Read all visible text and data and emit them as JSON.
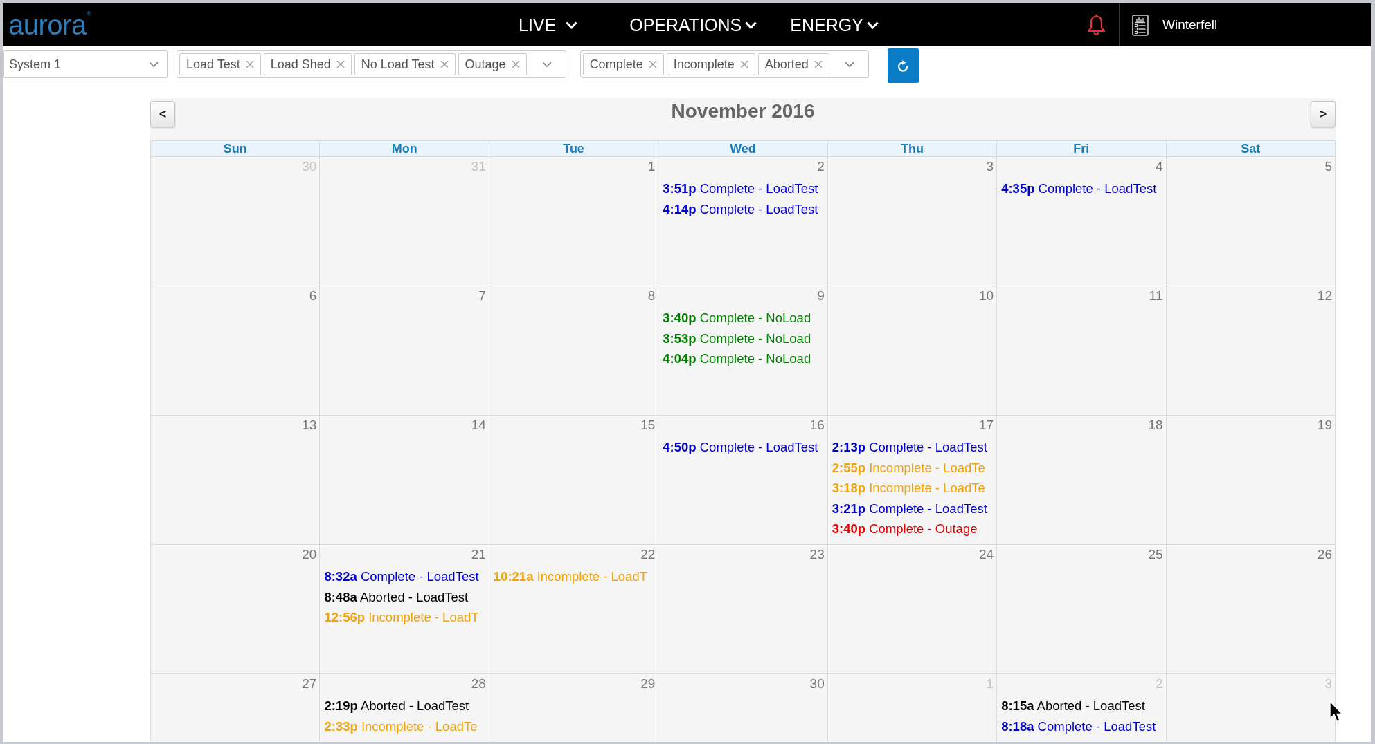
{
  "nav": {
    "logo": "aurora$^{®}$",
    "menus": [
      {
        "label": "LIVE"
      },
      {
        "label": "OPERATIONS"
      },
      {
        "label": "ENERGY"
      }
    ],
    "site": "Winterfell"
  },
  "filters": {
    "system": {
      "value": "System 1"
    },
    "event_types": [
      {
        "label": "Load Test"
      },
      {
        "label": "Load Shed"
      },
      {
        "label": "No Load Test"
      },
      {
        "label": "Outage"
      }
    ],
    "statuses": [
      {
        "label": "Complete"
      },
      {
        "label": "Incomplete"
      },
      {
        "label": "Aborted"
      }
    ]
  },
  "calendar": {
    "title": "November 2016",
    "prev": "<",
    "next": ">",
    "weekdays": [
      "Sun",
      "Mon",
      "Tue",
      "Wed",
      "Thu",
      "Fri",
      "Sat"
    ],
    "weeks": [
      {
        "days": [
          {
            "day": "30",
            "other_month": true
          },
          {
            "day": "31",
            "other_month": true
          },
          {
            "day": "1",
            "other_month": false
          },
          {
            "day": "2",
            "other_month": false,
            "events": [
              {
                "time": "3:51p",
                "text": "Complete - LoadTest",
                "color": "#0000cc"
              },
              {
                "time": "4:14p",
                "text": "Complete - LoadTest",
                "color": "#0000cc"
              }
            ]
          },
          {
            "day": "3",
            "other_month": false
          },
          {
            "day": "4",
            "other_month": false,
            "events": [
              {
                "time": "4:35p",
                "text": "Complete - LoadTest",
                "color": "#0000cc"
              }
            ]
          },
          {
            "day": "5",
            "other_month": false
          }
        ]
      },
      {
        "days": [
          {
            "day": "6",
            "other_month": false
          },
          {
            "day": "7",
            "other_month": false
          },
          {
            "day": "8",
            "other_month": false
          },
          {
            "day": "9",
            "other_month": false,
            "events": [
              {
                "time": "3:40p",
                "text": "Complete - NoLoad",
                "color": "#008000"
              },
              {
                "time": "3:53p",
                "text": "Complete - NoLoad",
                "color": "#008000"
              },
              {
                "time": "4:04p",
                "text": "Complete - NoLoad",
                "color": "#008000"
              }
            ]
          },
          {
            "day": "10",
            "other_month": false
          },
          {
            "day": "11",
            "other_month": false
          },
          {
            "day": "12",
            "other_month": false
          }
        ]
      },
      {
        "days": [
          {
            "day": "13",
            "other_month": false
          },
          {
            "day": "14",
            "other_month": false
          },
          {
            "day": "15",
            "other_month": false
          },
          {
            "day": "16",
            "other_month": false,
            "events": [
              {
                "time": "4:50p",
                "text": "Complete - LoadTest",
                "color": "#0000cc"
              }
            ]
          },
          {
            "day": "17",
            "other_month": false,
            "events": [
              {
                "time": "2:13p",
                "text": "Complete - LoadTest",
                "color": "#0000cc"
              },
              {
                "time": "2:55p",
                "text": "Incomplete - LoadTe",
                "color": "#f0a30a"
              },
              {
                "time": "3:18p",
                "text": "Incomplete - LoadTe",
                "color": "#f0a30a"
              },
              {
                "time": "3:21p",
                "text": "Complete - LoadTest",
                "color": "#0000cc"
              },
              {
                "time": "3:40p",
                "text": "Complete - Outage",
                "color": "#e00000"
              }
            ]
          },
          {
            "day": "18",
            "other_month": false
          },
          {
            "day": "19",
            "other_month": false
          }
        ]
      },
      {
        "days": [
          {
            "day": "20",
            "other_month": false
          },
          {
            "day": "21",
            "other_month": false,
            "events": [
              {
                "time": "8:32a",
                "text": "Complete - LoadTest",
                "color": "#0000cc"
              },
              {
                "time": "8:48a",
                "text": "Aborted - LoadTest",
                "color": "#000000"
              },
              {
                "time": "12:56p",
                "text": "Incomplete - LoadT",
                "color": "#f0a30a"
              }
            ]
          },
          {
            "day": "22",
            "other_month": false,
            "events": [
              {
                "time": "10:21a",
                "text": "Incomplete - LoadT",
                "color": "#f0a30a"
              }
            ]
          },
          {
            "day": "23",
            "other_month": false
          },
          {
            "day": "24",
            "other_month": false
          },
          {
            "day": "25",
            "other_month": false
          },
          {
            "day": "26",
            "other_month": false
          }
        ]
      },
      {
        "days": [
          {
            "day": "27",
            "other_month": false
          },
          {
            "day": "28",
            "other_month": false,
            "events": [
              {
                "time": "2:19p",
                "text": "Aborted - LoadTest",
                "color": "#000000"
              },
              {
                "time": "2:33p",
                "text": "Incomplete - LoadTe",
                "color": "#f0a30a"
              }
            ]
          },
          {
            "day": "29",
            "other_month": false
          },
          {
            "day": "30",
            "other_month": false
          },
          {
            "day": "1",
            "other_month": true
          },
          {
            "day": "2",
            "other_month": true,
            "events": [
              {
                "time": "8:15a",
                "text": "Aborted - LoadTest",
                "color": "#000000"
              },
              {
                "time": "8:18a",
                "text": "Complete - LoadTest",
                "color": "#0000cc"
              }
            ]
          },
          {
            "day": "3",
            "other_month": true
          }
        ]
      }
    ]
  }
}
